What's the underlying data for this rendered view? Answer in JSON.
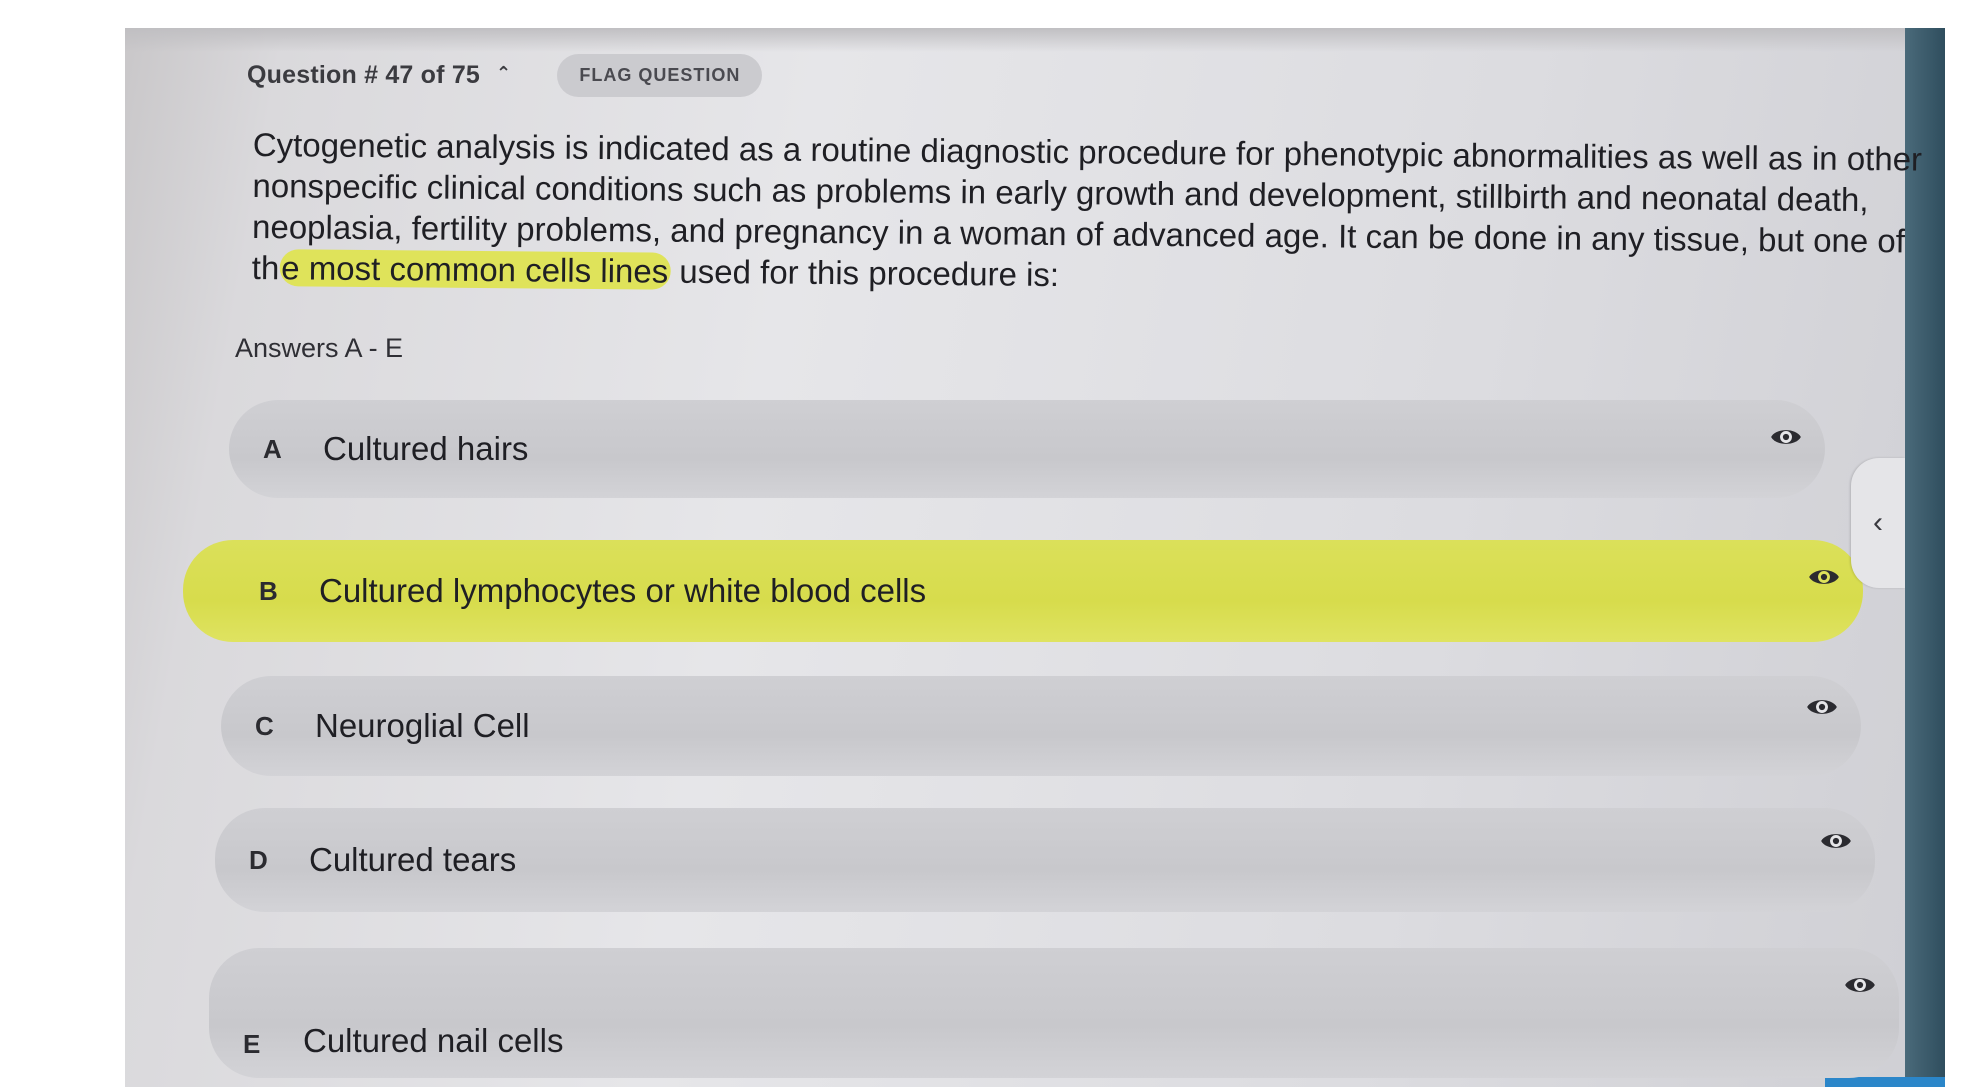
{
  "header": {
    "question_counter": "Question # 47 of 75",
    "flag_label": "FLAG QUESTION"
  },
  "question": {
    "text_before": "Cytogenetic analysis is indicated as a routine diagnostic procedure for phenotypic abnormalities as well as in other nonspecific clinical conditions such as problems in early growth and development, stillbirth and neonatal death, neoplasia, fertility problems, and pregnancy in a woman of advanced age.  It can be done in any tissue, but one of th",
    "text_highlighted": "e most common cells lines",
    "text_after": " used for this procedure is:"
  },
  "answers_label": "Answers A - E",
  "options": [
    {
      "letter": "A",
      "text": "Cultured hairs",
      "selected": false
    },
    {
      "letter": "B",
      "text": "Cultured lymphocytes or white blood cells",
      "selected": true
    },
    {
      "letter": "C",
      "text": "Neuroglial Cell",
      "selected": false
    },
    {
      "letter": "D",
      "text": "Cultured tears",
      "selected": false
    },
    {
      "letter": "E",
      "text": "Cultured nail cells",
      "selected": false
    }
  ],
  "icons": {
    "counter_toggle": "chevron-up-icon",
    "option_reveal": "eye-icon",
    "side_panel_toggle": "chevron-left-icon"
  },
  "colors": {
    "highlight": "#dfe35a",
    "option_background": "#cbcbcf"
  }
}
